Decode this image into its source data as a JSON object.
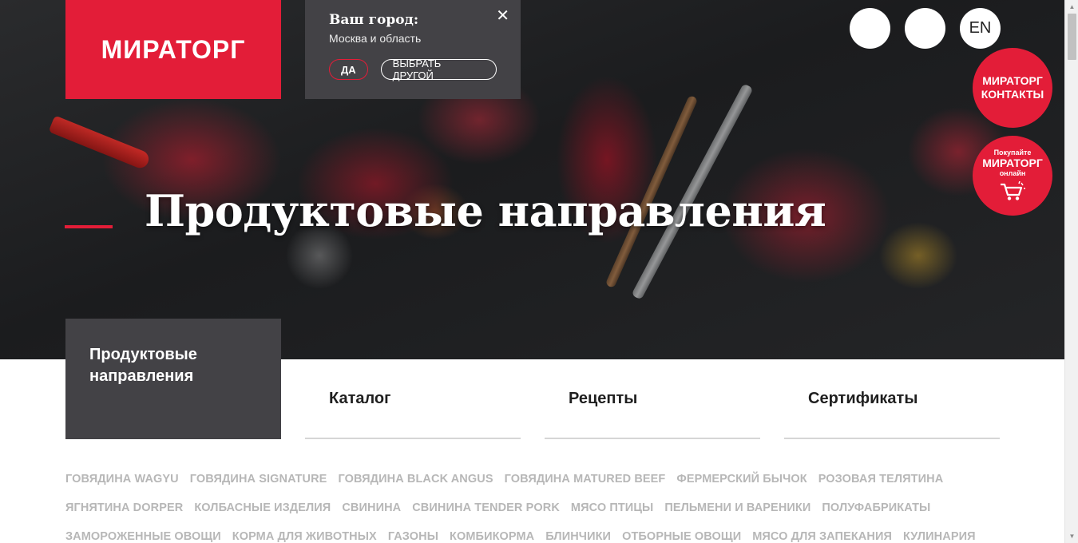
{
  "logo": {
    "text": "МИРАТОРГ"
  },
  "city_popup": {
    "title": "Ваш город:",
    "city": "Москва и область",
    "yes_label": "ДА",
    "choose_other_label": "ВЫБРАТЬ ДРУГОЙ",
    "close_symbol": "✕"
  },
  "header": {
    "lang_label": "EN"
  },
  "badges": {
    "contacts_line1": "МИРАТОРГ",
    "contacts_line2": "КОНТАКТЫ",
    "shop_line1": "Покупайте",
    "shop_line2": "МИРАТОРГ",
    "shop_line3": "онлайн"
  },
  "hero": {
    "title": "Продуктовые направления"
  },
  "tabs": [
    {
      "label": "Продуктовые направления"
    },
    {
      "label": "Каталог"
    },
    {
      "label": "Рецепты"
    },
    {
      "label": "Сертификаты"
    }
  ],
  "categories": [
    "ГОВЯДИНА WAGYU",
    "ГОВЯДИНА SIGNATURE",
    "ГОВЯДИНА BLACK ANGUS",
    "ГОВЯДИНА MATURED BEEF",
    "ФЕРМЕРСКИЙ БЫЧОК",
    "РОЗОВАЯ ТЕЛЯТИНА",
    "ЯГНЯТИНА DORPER",
    "КОЛБАСНЫЕ ИЗДЕЛИЯ",
    "СВИНИНА",
    "СВИНИНА TENDER PORK",
    "МЯСО ПТИЦЫ",
    "ПЕЛЬМЕНИ И ВАРЕНИКИ",
    "ПОЛУФАБРИКАТЫ",
    "ЗАМОРОЖЕННЫЕ ОВОЩИ",
    "КОРМА ДЛЯ ЖИВОТНЫХ",
    "ГАЗОНЫ",
    "КОМБИКОРМА",
    "БЛИНЧИКИ",
    "ОТБОРНЫЕ ОВОЩИ",
    "МЯСО ДЛЯ ЗАПЕКАНИЯ",
    "КУЛИНАРИЯ"
  ],
  "colors": {
    "brand_red": "#e31d38",
    "dark_panel": "#434246",
    "category_gray": "#b7b7b7"
  }
}
